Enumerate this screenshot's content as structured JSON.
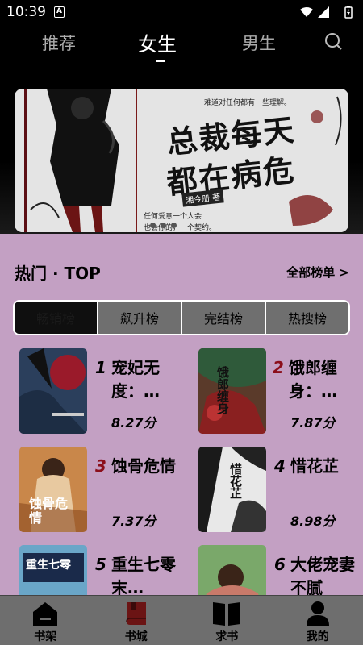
{
  "status_bar": {
    "time": "10:39",
    "notification_letter": "A"
  },
  "top_nav": {
    "tabs": [
      {
        "label": "推荐",
        "active": false
      },
      {
        "label": "女生",
        "active": true
      },
      {
        "label": "男生",
        "active": false
      }
    ],
    "search_icon": "search-icon"
  },
  "banner": {
    "title_line1": "总裁每天",
    "title_line2": "都在病危",
    "top_text": "难道对任何都有一些理解。",
    "author_tag": "湘今册·著",
    "line1": "任何爱意一个人会",
    "line2": "也会你的，一个契约。",
    "dots": 3
  },
  "section": {
    "title": "热门 · TOP",
    "more": "全部榜单 >"
  },
  "rank_tabs": [
    {
      "label": "畅销榜",
      "active": true
    },
    {
      "label": "飙升榜",
      "active": false
    },
    {
      "label": "完结榜",
      "active": false
    },
    {
      "label": "热搜榜",
      "active": false
    }
  ],
  "books": [
    {
      "rank": "1",
      "title": "宠妃无度：…",
      "score": "8.27分",
      "cover_text": ""
    },
    {
      "rank": "2",
      "title": "饿郎缠身：…",
      "score": "7.87分",
      "cover_text": "饿郎缠身"
    },
    {
      "rank": "3",
      "title": "蚀骨危情",
      "score": "7.37分",
      "cover_text": "蚀骨危情"
    },
    {
      "rank": "4",
      "title": "惜花芷",
      "score": "8.98分",
      "cover_text": "惜花芷"
    },
    {
      "rank": "5",
      "title": "重生七零末…",
      "score": "",
      "cover_text": "重生七零"
    },
    {
      "rank": "6",
      "title": "大佬宠妻不腻",
      "score": "",
      "cover_text": ""
    }
  ],
  "bottom_nav": [
    {
      "label": "书架",
      "icon": "bookshelf-icon"
    },
    {
      "label": "书城",
      "icon": "bookstore-icon"
    },
    {
      "label": "求书",
      "icon": "book-request-icon"
    },
    {
      "label": "我的",
      "icon": "profile-icon"
    }
  ],
  "colors": {
    "content_bg": "#c3a0c3",
    "rank_red": "#8b0e1a",
    "bottom_bar": "#6e6e6e",
    "active_icon": "#6b1414"
  }
}
